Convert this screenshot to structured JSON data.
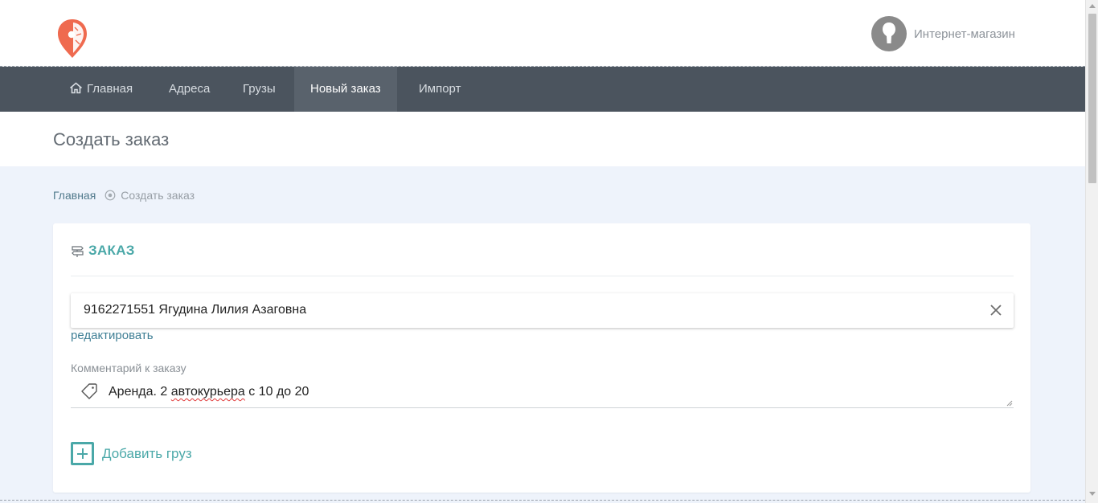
{
  "brand": {
    "logo_icon": "map-pin-logo-icon",
    "accent": "#ef6a4f"
  },
  "user": {
    "name": "Интернет-магазин",
    "avatar_icon": "user-avatar-icon"
  },
  "nav": {
    "items": [
      {
        "label": "Главная",
        "icon": "home-icon",
        "active": false
      },
      {
        "label": "Адреса",
        "active": false
      },
      {
        "label": "Грузы",
        "active": false
      },
      {
        "label": "Новый заказ",
        "active": true
      },
      {
        "label": "Импорт",
        "active": false
      }
    ],
    "background": "#4b545e",
    "active_background": "#59626c"
  },
  "page": {
    "title": "Создать заказ"
  },
  "breadcrumb": {
    "home": "Главная",
    "current": "Создать заказ"
  },
  "order": {
    "header": "ЗАКАЗ",
    "header_icon": "signpost-icon",
    "client_value": "9162271551 Ягудина Лилия Азаговна",
    "edit_link": "редактировать",
    "comment_label": "Комментарий к заказу",
    "comment_prefix": "Аренда. 2 ",
    "comment_misspelled": "автокурьера",
    "comment_suffix": " с 10 до 20",
    "comment_icon": "tag-icon",
    "add_cargo": "Добавить груз",
    "accent": "#4aa8a8"
  }
}
